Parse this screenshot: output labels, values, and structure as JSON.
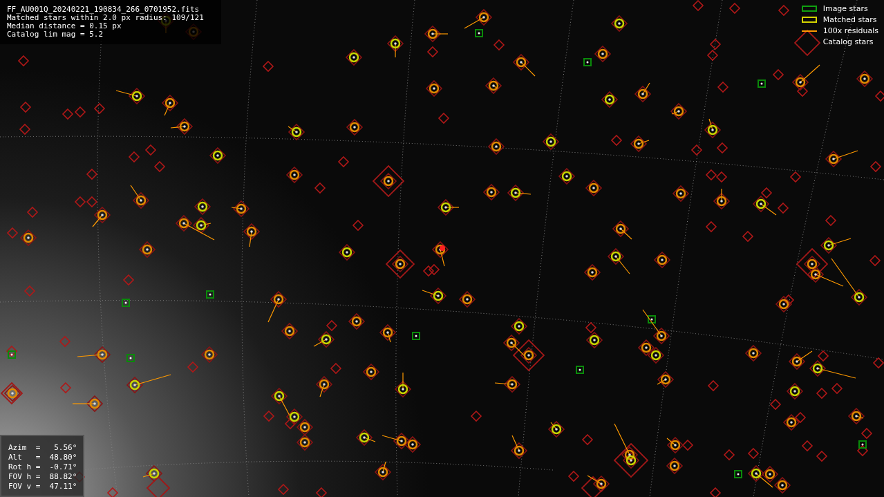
{
  "info": {
    "lines": [
      "FF_AU001Q_20240221_190834_266_0701952.fits",
      "Matched stars within 2.0 px radius: 109/121",
      "Median distance = 0.15 px",
      "Catalog lim mag = 5.2"
    ]
  },
  "legend": [
    {
      "kind": "image",
      "label": "Image stars"
    },
    {
      "kind": "matched",
      "label": "Matched stars"
    },
    {
      "kind": "residual",
      "label": "100x residuals"
    },
    {
      "kind": "catalog",
      "label": "Catalog stars"
    }
  ],
  "pointing": {
    "lines": [
      "Azim  =   5.56°",
      "Alt   =  48.80°",
      "Rot h =  -0.71°",
      "FOV h =  88.82°",
      "FOV v =  47.11°"
    ]
  }
}
